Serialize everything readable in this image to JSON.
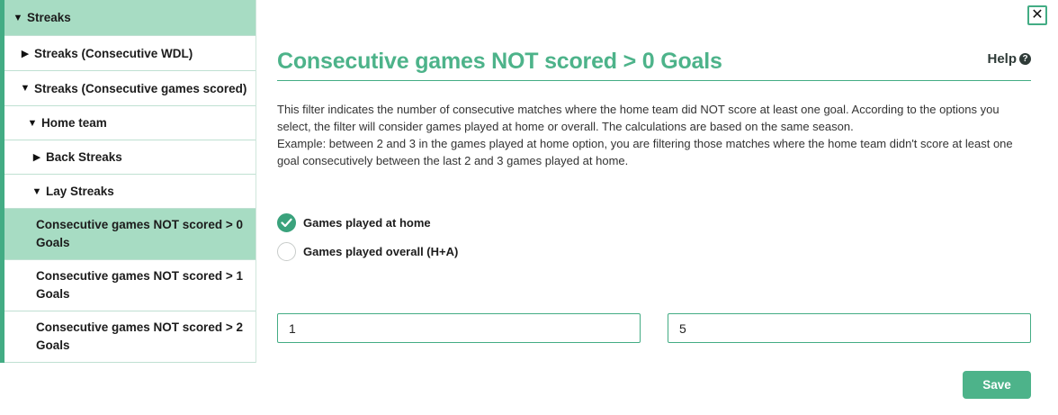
{
  "sidebar": {
    "items": [
      {
        "label": "Streaks",
        "caret": "▼"
      },
      {
        "label": "Streaks (Consecutive WDL)",
        "caret": "▶"
      },
      {
        "label": "Streaks (Consecutive games scored)",
        "caret": "▼"
      },
      {
        "label": "Home team",
        "caret": "▼"
      },
      {
        "label": "Back Streaks",
        "caret": "▶"
      },
      {
        "label": "Lay Streaks",
        "caret": "▼"
      },
      {
        "label": "Consecutive games NOT scored > 0 Goals"
      },
      {
        "label": "Consecutive games NOT scored > 1 Goals"
      },
      {
        "label": "Consecutive games NOT scored > 2 Goals"
      }
    ]
  },
  "close": {
    "glyph": "✕"
  },
  "main": {
    "title": "Consecutive games NOT scored > 0 Goals",
    "help_label": "Help",
    "help_icon": "?",
    "description_1": "This filter indicates the number of consecutive matches where the home team did NOT score at least one goal. According to the options you select, the filter will consider games played at home or overall. The calculations are based on the same season.",
    "description_2": "Example: between 2 and 3 in the games played at home option, you are filtering those matches where the home team didn't score at least one goal consecutively between the last 2 and 3 games played at home.",
    "options": [
      {
        "label": "Games played at home",
        "checked": true
      },
      {
        "label": "Games played overall (H+A)",
        "checked": false
      }
    ],
    "min_value": "1",
    "max_value": "5",
    "save_label": "Save"
  },
  "colors": {
    "accent": "#4db38a",
    "sidebar_active": "#a7dcc3",
    "radio_checked": "#3aa27c"
  }
}
